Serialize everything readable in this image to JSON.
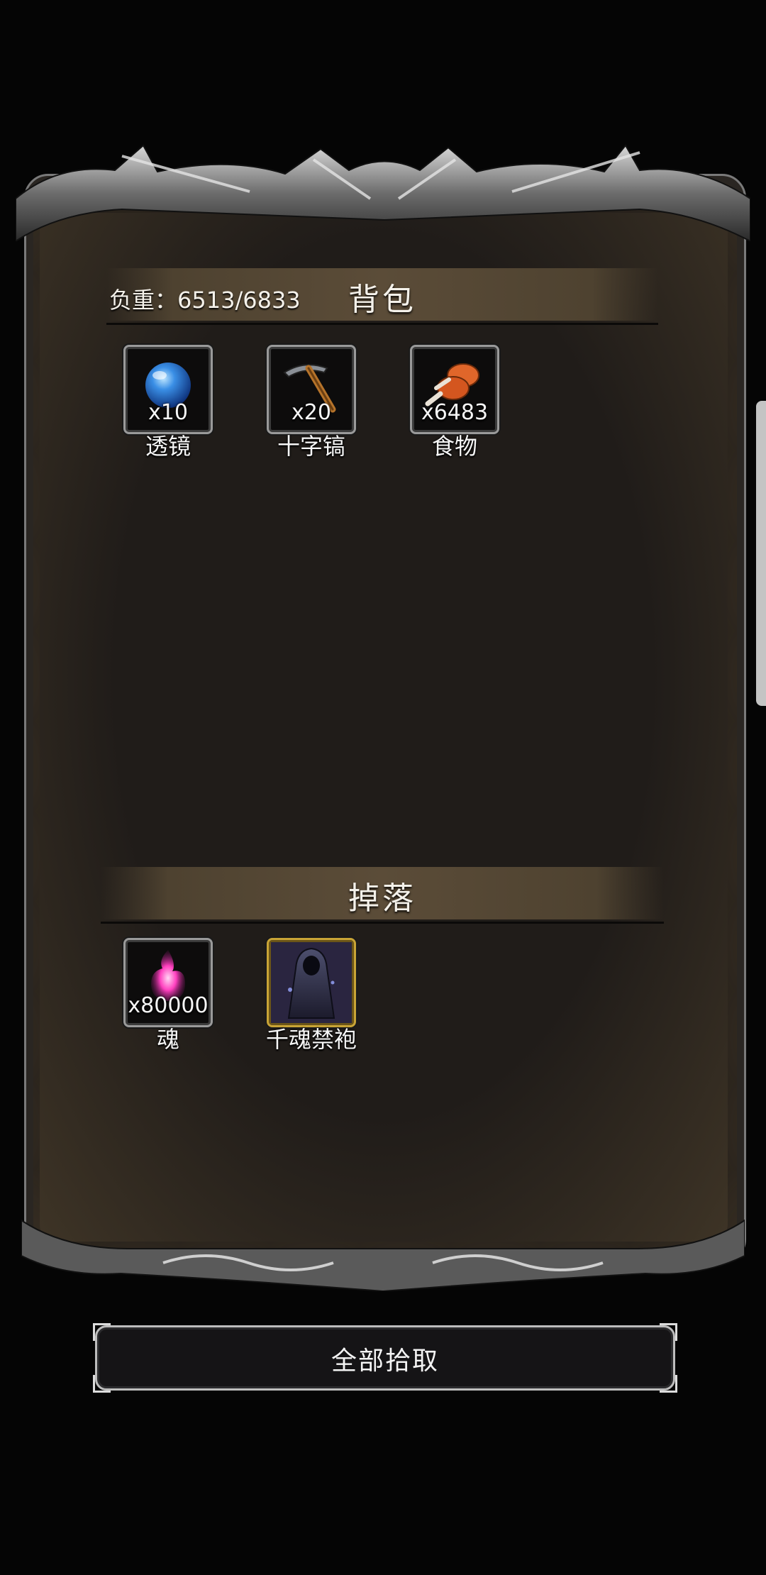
{
  "backpack": {
    "title": "背包",
    "weight_label": "负重：6513/6833",
    "items": [
      {
        "name": "透镜",
        "qty": "x10",
        "icon": "blue-orb-icon"
      },
      {
        "name": "十字镐",
        "qty": "x20",
        "icon": "pickaxe-icon"
      },
      {
        "name": "食物",
        "qty": "x6483",
        "icon": "meat-drumstick-icon"
      }
    ]
  },
  "drops": {
    "title": "掉落",
    "items": [
      {
        "name": "魂",
        "qty": "x80000",
        "icon": "pink-soul-icon"
      },
      {
        "name": "千魂禁袍",
        "qty": "",
        "icon": "hooded-robe-icon",
        "rarity_color": "#c9a436"
      }
    ]
  },
  "pickup_all_button": {
    "label": "全部拾取"
  }
}
